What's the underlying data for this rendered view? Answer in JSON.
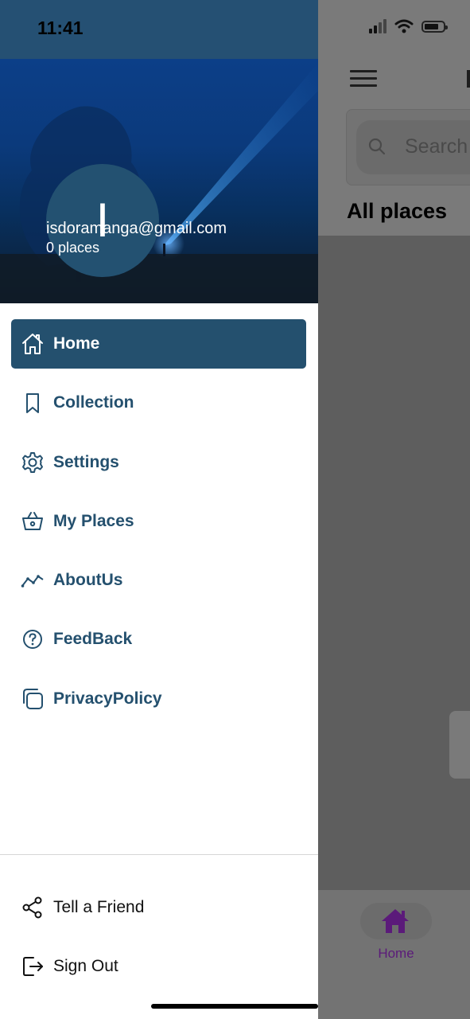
{
  "status_bar": {
    "time": "11:41"
  },
  "profile": {
    "avatar_initial": "I",
    "email": "isdoramanga@gmail.com",
    "places_count": "0 places"
  },
  "menu": {
    "items": [
      {
        "label": "Home",
        "icon": "home-icon",
        "active": true
      },
      {
        "label": "Collection",
        "icon": "bookmark-icon"
      },
      {
        "label": "Settings",
        "icon": "gear-icon"
      },
      {
        "label": "My Places",
        "icon": "basket-icon"
      },
      {
        "label": "AboutUs",
        "icon": "trend-line-icon"
      },
      {
        "label": "FeedBack",
        "icon": "help-circle-icon"
      },
      {
        "label": "PrivacyPolicy",
        "icon": "copy-icon"
      }
    ]
  },
  "footer": {
    "tell_friend": "Tell a Friend",
    "sign_out": "Sign Out"
  },
  "background_app": {
    "search_placeholder": "Search",
    "section_title": "All places",
    "tab_home_label": "Home"
  },
  "colors": {
    "primary": "#24506e",
    "tab_accent": "#5b1a7a"
  }
}
